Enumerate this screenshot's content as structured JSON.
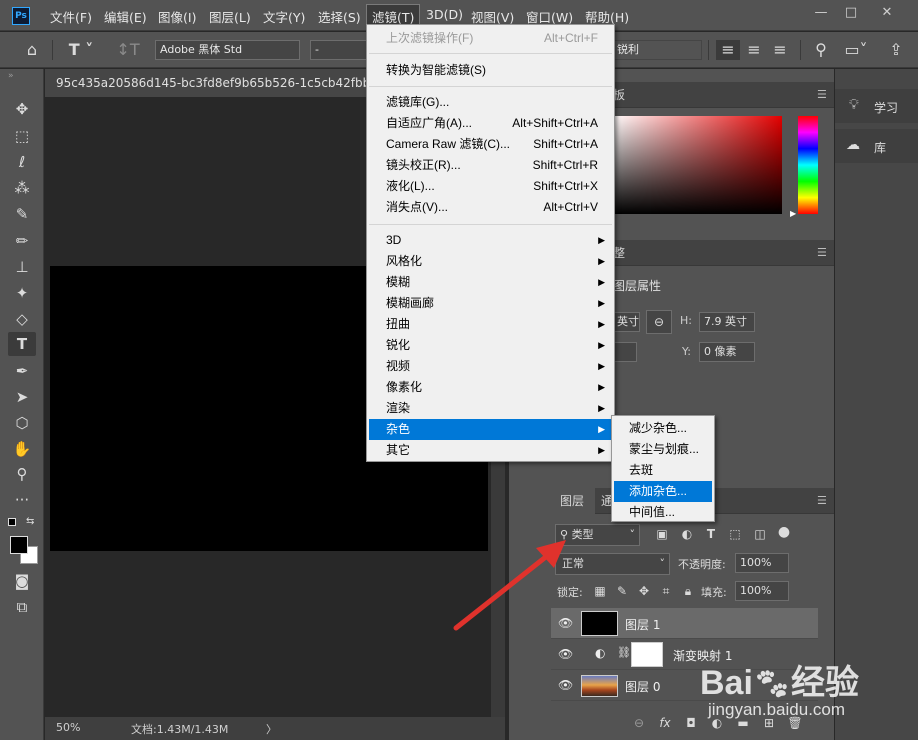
{
  "menubar": {
    "logo": "Ps",
    "items": [
      "文件(F)",
      "编辑(E)",
      "图像(I)",
      "图层(L)",
      "文字(Y)",
      "选择(S)",
      "滤镜(T)",
      "3D(D)",
      "视图(V)",
      "窗口(W)",
      "帮助(H)"
    ],
    "window_controls": {
      "minimize": "—",
      "maximize": "□",
      "close": "✕"
    }
  },
  "optionsbar": {
    "font_family": "Adobe 黑体 Std",
    "font_style": "-",
    "antialias": "锐利"
  },
  "document": {
    "tab_title": "95c435a20586d145-bc3fd8ef9b65b526-1c5cb42fbba16",
    "zoom": "50%",
    "doc_info": "文档:1.43M/1.43M",
    "status_arrow": "〉"
  },
  "filter_menu": {
    "items": [
      {
        "label": "上次滤镜操作(F)",
        "shortcut": "Alt+Ctrl+F",
        "disabled": true
      },
      {
        "label": "转换为智能滤镜(S)",
        "shortcut": ""
      },
      {
        "label": "滤镜库(G)...",
        "shortcut": ""
      },
      {
        "label": "自适应广角(A)...",
        "shortcut": "Alt+Shift+Ctrl+A"
      },
      {
        "label": "Camera Raw 滤镜(C)...",
        "shortcut": "Shift+Ctrl+A"
      },
      {
        "label": "镜头校正(R)...",
        "shortcut": "Shift+Ctrl+R"
      },
      {
        "label": "液化(L)...",
        "shortcut": "Shift+Ctrl+X"
      },
      {
        "label": "消失点(V)...",
        "shortcut": "Alt+Ctrl+V"
      },
      {
        "label": "3D"
      },
      {
        "label": "风格化"
      },
      {
        "label": "模糊"
      },
      {
        "label": "模糊画廊"
      },
      {
        "label": "扭曲"
      },
      {
        "label": "锐化"
      },
      {
        "label": "视频"
      },
      {
        "label": "像素化"
      },
      {
        "label": "渲染"
      },
      {
        "label": "杂色"
      },
      {
        "label": "其它"
      }
    ],
    "arrow": "▶"
  },
  "noise_submenu": {
    "items": [
      "减少杂色...",
      "蒙尘与划痕...",
      "去斑",
      "添加杂色...",
      "中间值..."
    ]
  },
  "color_panel": {
    "tab": "板"
  },
  "properties_panel": {
    "tab": "整",
    "title": "图层属性",
    "w_value": "英寸",
    "h_label": "H:",
    "h_value": "7.9 英寸",
    "y_label": "Y:",
    "y_value": "0 像素"
  },
  "far_panel": {
    "learn": "学习",
    "library": "库"
  },
  "layers_panel": {
    "tab_layers": "图层",
    "tab_channels": "通",
    "filter_kind": "类型",
    "blend_mode": "正常",
    "opacity_label": "不透明度:",
    "opacity_value": "100%",
    "lock_label": "锁定:",
    "fill_label": "填充:",
    "fill_value": "100%",
    "layers": [
      {
        "name": "图层 1"
      },
      {
        "name": "渐变映射 1"
      },
      {
        "name": "图层 0"
      }
    ]
  },
  "watermark": {
    "brand": "Bai",
    "brand2": "经验",
    "url": "jingyan.baidu.com"
  },
  "colors": {
    "highlight": "#0078d7",
    "arrow": "#e0322c"
  }
}
